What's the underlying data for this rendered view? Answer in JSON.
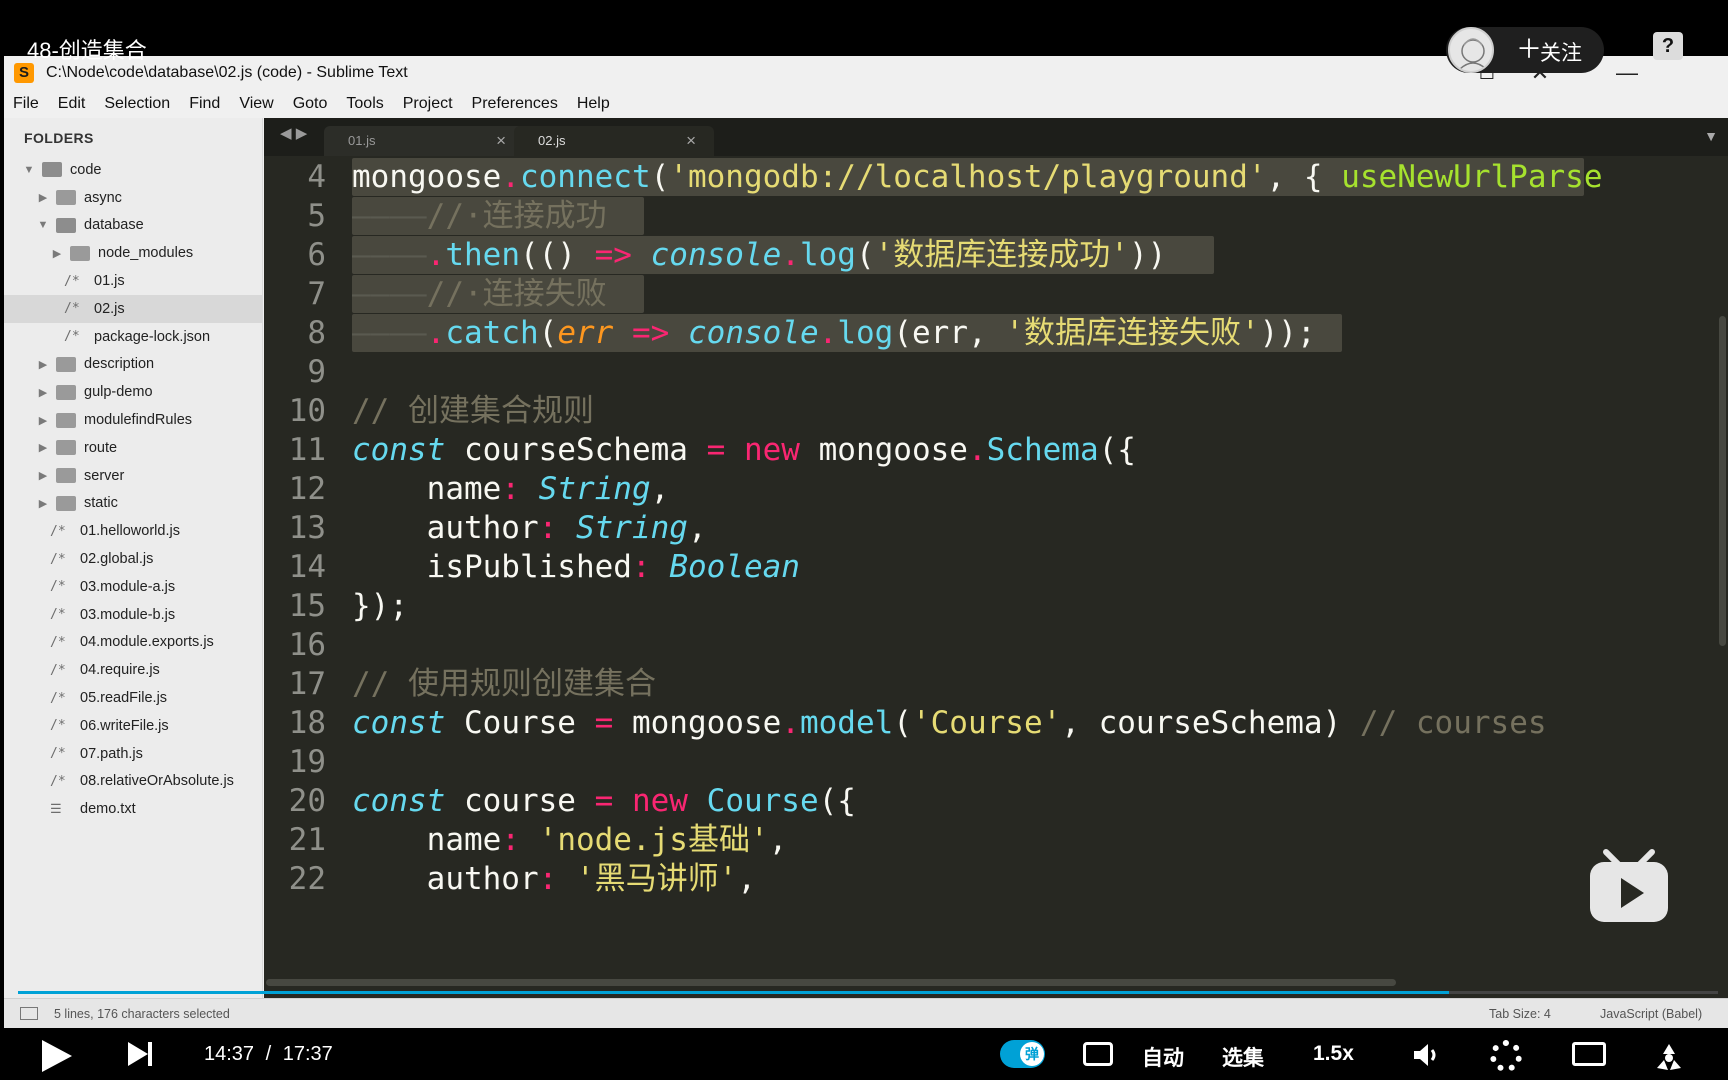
{
  "video": {
    "title": "48-创造集合",
    "follow_label": "关注",
    "follow_plus": "＋",
    "help_label": "?",
    "current_time": "14:37",
    "time_sep": "/",
    "duration": "17:37",
    "progress": 0.842,
    "danmu_label": "弹",
    "auto_label": "自动",
    "episodes_label": "选集",
    "speed_label": "1.5x",
    "accent_color": "#00a1d6"
  },
  "window": {
    "title": "C:\\Node\\code\\database\\02.js (code) - Sublime Text",
    "logo": "S",
    "minimize": "—",
    "maximize": "☐",
    "close": "✕"
  },
  "menu": [
    "File",
    "Edit",
    "Selection",
    "Find",
    "View",
    "Goto",
    "Tools",
    "Project",
    "Preferences",
    "Help"
  ],
  "sidebar": {
    "header": "FOLDERS",
    "items": [
      {
        "label": "code",
        "type": "folder",
        "open": true,
        "level": 0
      },
      {
        "label": "async",
        "type": "folder",
        "open": false,
        "level": 1
      },
      {
        "label": "database",
        "type": "folder",
        "open": true,
        "level": 1
      },
      {
        "label": "node_modules",
        "type": "folder",
        "open": false,
        "level": 2
      },
      {
        "label": "01.js",
        "type": "file",
        "level": 2
      },
      {
        "label": "02.js",
        "type": "file",
        "level": 2,
        "selected": true
      },
      {
        "label": "package-lock.json",
        "type": "file",
        "level": 2
      },
      {
        "label": "description",
        "type": "folder",
        "open": false,
        "level": 1
      },
      {
        "label": "gulp-demo",
        "type": "folder",
        "open": false,
        "level": 1
      },
      {
        "label": "modulefindRules",
        "type": "folder",
        "open": false,
        "level": 1
      },
      {
        "label": "route",
        "type": "folder",
        "open": false,
        "level": 1
      },
      {
        "label": "server",
        "type": "folder",
        "open": false,
        "level": 1
      },
      {
        "label": "static",
        "type": "folder",
        "open": false,
        "level": 1
      },
      {
        "label": "01.helloworld.js",
        "type": "file",
        "level": 1
      },
      {
        "label": "02.global.js",
        "type": "file",
        "level": 1
      },
      {
        "label": "03.module-a.js",
        "type": "file",
        "level": 1
      },
      {
        "label": "03.module-b.js",
        "type": "file",
        "level": 1
      },
      {
        "label": "04.module.exports.js",
        "type": "file",
        "level": 1
      },
      {
        "label": "04.require.js",
        "type": "file",
        "level": 1
      },
      {
        "label": "05.readFile.js",
        "type": "file",
        "level": 1
      },
      {
        "label": "06.writeFile.js",
        "type": "file",
        "level": 1
      },
      {
        "label": "07.path.js",
        "type": "file",
        "level": 1
      },
      {
        "label": "08.relativeOrAbsolute.js",
        "type": "file",
        "level": 1
      },
      {
        "label": "demo.txt",
        "type": "text",
        "level": 1
      }
    ]
  },
  "tabs": [
    {
      "label": "01.js",
      "active": false
    },
    {
      "label": "02.js",
      "active": true
    }
  ],
  "code_lines": [
    {
      "n": "4",
      "sel": true,
      "tokens": [
        [
          "",
          "mongoose"
        ],
        [
          "kw",
          "."
        ],
        [
          "fn",
          "connect"
        ],
        [
          "",
          "("
        ],
        [
          "st",
          "'mongodb://localhost/playground'"
        ],
        [
          "",
          ", { "
        ],
        [
          "ar",
          "useNewUrlParse"
        ]
      ]
    },
    {
      "n": "5",
      "sel": true,
      "tokens": [
        [
          "ws",
          "————"
        ],
        [
          "cm",
          "//·连接成功"
        ]
      ]
    },
    {
      "n": "6",
      "sel": true,
      "tokens": [
        [
          "ws",
          "————"
        ],
        [
          "kw",
          "."
        ],
        [
          "fn",
          "then"
        ],
        [
          "",
          "(() "
        ],
        [
          "kw",
          "=>"
        ],
        [
          "",
          " "
        ],
        [
          "fn it",
          "console"
        ],
        [
          "kw",
          "."
        ],
        [
          "fn",
          "log"
        ],
        [
          "",
          "("
        ],
        [
          "st",
          "'数据库连接成功'"
        ],
        [
          "",
          "))"
        ]
      ]
    },
    {
      "n": "7",
      "sel": true,
      "tokens": [
        [
          "ws",
          "————"
        ],
        [
          "cm",
          "//·连接失败"
        ]
      ]
    },
    {
      "n": "8",
      "sel": true,
      "tokens": [
        [
          "ws",
          "————"
        ],
        [
          "kw",
          "."
        ],
        [
          "fn",
          "catch"
        ],
        [
          "",
          "("
        ],
        [
          "pa",
          "err"
        ],
        [
          "",
          " "
        ],
        [
          "kw",
          "=>"
        ],
        [
          "",
          " "
        ],
        [
          "fn it",
          "console"
        ],
        [
          "kw",
          "."
        ],
        [
          "fn",
          "log"
        ],
        [
          "",
          "(err, "
        ],
        [
          "st",
          "'数据库连接失败'"
        ],
        [
          "",
          "));"
        ]
      ]
    },
    {
      "n": "9",
      "sel": false,
      "tokens": []
    },
    {
      "n": "10",
      "sel": false,
      "tokens": [
        [
          "cm",
          "// 创建集合规则"
        ]
      ]
    },
    {
      "n": "11",
      "sel": false,
      "tokens": [
        [
          "fn it",
          "const"
        ],
        [
          "",
          " courseSchema "
        ],
        [
          "kw",
          "="
        ],
        [
          "",
          " "
        ],
        [
          "kw",
          "new"
        ],
        [
          "",
          " mongoose"
        ],
        [
          "kw",
          "."
        ],
        [
          "fn",
          "Schema"
        ],
        [
          "",
          "({"
        ]
      ]
    },
    {
      "n": "12",
      "sel": false,
      "tokens": [
        [
          "",
          "    name"
        ],
        [
          "kw",
          ":"
        ],
        [
          "",
          " "
        ],
        [
          "fn it",
          "String"
        ],
        [
          "",
          ","
        ]
      ]
    },
    {
      "n": "13",
      "sel": false,
      "tokens": [
        [
          "",
          "    author"
        ],
        [
          "kw",
          ":"
        ],
        [
          "",
          " "
        ],
        [
          "fn it",
          "String"
        ],
        [
          "",
          ","
        ]
      ]
    },
    {
      "n": "14",
      "sel": false,
      "tokens": [
        [
          "",
          "    isPublished"
        ],
        [
          "kw",
          ":"
        ],
        [
          "",
          " "
        ],
        [
          "fn it",
          "Boolean"
        ]
      ]
    },
    {
      "n": "15",
      "sel": false,
      "tokens": [
        [
          "",
          "});"
        ]
      ]
    },
    {
      "n": "16",
      "sel": false,
      "tokens": []
    },
    {
      "n": "17",
      "sel": false,
      "tokens": [
        [
          "cm",
          "// 使用规则创建集合"
        ]
      ]
    },
    {
      "n": "18",
      "sel": false,
      "tokens": [
        [
          "fn it",
          "const"
        ],
        [
          "",
          " Course "
        ],
        [
          "kw",
          "="
        ],
        [
          "",
          " mongoose"
        ],
        [
          "kw",
          "."
        ],
        [
          "fn",
          "model"
        ],
        [
          "",
          "("
        ],
        [
          "st",
          "'Course'"
        ],
        [
          "",
          ", courseSchema) "
        ],
        [
          "cm",
          "// courses"
        ]
      ]
    },
    {
      "n": "19",
      "sel": false,
      "tokens": []
    },
    {
      "n": "20",
      "sel": false,
      "tokens": [
        [
          "fn it",
          "const"
        ],
        [
          "",
          " course "
        ],
        [
          "kw",
          "="
        ],
        [
          "",
          " "
        ],
        [
          "kw",
          "new"
        ],
        [
          "",
          " "
        ],
        [
          "fn",
          "Course"
        ],
        [
          "",
          "({"
        ]
      ]
    },
    {
      "n": "21",
      "sel": false,
      "tokens": [
        [
          "",
          "    name"
        ],
        [
          "kw",
          ":"
        ],
        [
          "",
          " "
        ],
        [
          "st",
          "'node.js基础'"
        ],
        [
          "",
          ","
        ]
      ]
    },
    {
      "n": "22",
      "sel": false,
      "tokens": [
        [
          "",
          "    author"
        ],
        [
          "kw",
          ":"
        ],
        [
          "",
          " "
        ],
        [
          "st",
          "'黑马讲师'"
        ],
        [
          "",
          ","
        ]
      ]
    }
  ],
  "status": {
    "selection": "5 lines, 176 characters selected",
    "tab_size": "Tab Size: 4",
    "syntax": "JavaScript (Babel)"
  },
  "icons": {
    "play": "play-icon",
    "next": "next-episode-icon",
    "volume": "volume-icon",
    "settings": "gear-icon",
    "pip": "picture-in-picture-icon",
    "fullscreen": "fullscreen-fan-icon",
    "danmu_settings": "danmu-settings-icon"
  }
}
